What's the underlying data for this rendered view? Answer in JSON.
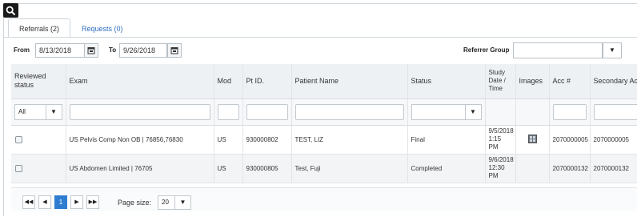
{
  "tabs": [
    {
      "label": "Referrals (2)"
    },
    {
      "label": "Requests (0)"
    }
  ],
  "filters": {
    "from_label": "From",
    "from_value": "8/13/2018",
    "to_label": "To",
    "to_value": "9/26/2018",
    "referrer_group_label": "Referrer Group",
    "referrer_group_value": ""
  },
  "grid": {
    "columns": [
      "Reviewed status",
      "Exam",
      "Mod",
      "Pt ID.",
      "Patient Name",
      "Status",
      "Study Date / Time",
      "Images",
      "Acc #",
      "Secondary Acc#"
    ],
    "status_filter_value": "All",
    "rows": [
      {
        "exam": "US Pelvis Comp Non OB | 76856,76830",
        "mod": "US",
        "pt_id": "930000802",
        "patient_name": "TEST, LIZ",
        "status": "Final",
        "study_date": "9/5/2018 1:15 PM",
        "acc": "2070000005",
        "secondary_acc": "2070000005"
      },
      {
        "exam": "US Abdomen Limited | 76705",
        "mod": "US",
        "pt_id": "930000805",
        "patient_name": "Test, Fuji",
        "status": "Completed",
        "study_date": "9/6/2018 12:30 PM",
        "acc": "2070000132",
        "secondary_acc": "2070000132"
      }
    ]
  },
  "pager": {
    "current_page": "1",
    "page_size_label": "Page size:",
    "page_size_value": "20"
  },
  "icons": {
    "first": "first-page-icon",
    "prev": "prev-page-icon",
    "next": "next-page-icon",
    "last": "last-page-icon",
    "arrow": "▼"
  }
}
